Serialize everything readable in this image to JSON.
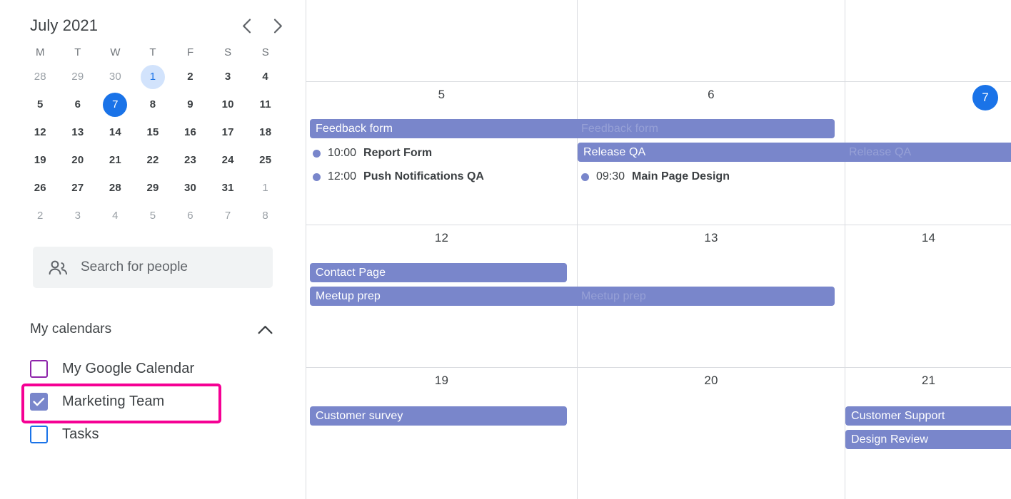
{
  "sidebar": {
    "mini_calendar": {
      "title": "July 2021",
      "prev_label": "‹",
      "next_label": "›",
      "day_initials": [
        "M",
        "T",
        "W",
        "T",
        "F",
        "S",
        "S"
      ],
      "weeks": [
        [
          {
            "n": "28",
            "state": "muted"
          },
          {
            "n": "29",
            "state": "muted"
          },
          {
            "n": "30",
            "state": "muted"
          },
          {
            "n": "1",
            "state": "selected"
          },
          {
            "n": "2",
            "state": "normal"
          },
          {
            "n": "3",
            "state": "normal"
          },
          {
            "n": "4",
            "state": "normal"
          }
        ],
        [
          {
            "n": "5",
            "state": "normal"
          },
          {
            "n": "6",
            "state": "normal"
          },
          {
            "n": "7",
            "state": "today"
          },
          {
            "n": "8",
            "state": "normal"
          },
          {
            "n": "9",
            "state": "normal"
          },
          {
            "n": "10",
            "state": "normal"
          },
          {
            "n": "11",
            "state": "normal"
          }
        ],
        [
          {
            "n": "12",
            "state": "normal"
          },
          {
            "n": "13",
            "state": "normal"
          },
          {
            "n": "14",
            "state": "normal"
          },
          {
            "n": "15",
            "state": "normal"
          },
          {
            "n": "16",
            "state": "normal"
          },
          {
            "n": "17",
            "state": "normal"
          },
          {
            "n": "18",
            "state": "normal"
          }
        ],
        [
          {
            "n": "19",
            "state": "normal"
          },
          {
            "n": "20",
            "state": "normal"
          },
          {
            "n": "21",
            "state": "normal"
          },
          {
            "n": "22",
            "state": "normal"
          },
          {
            "n": "23",
            "state": "normal"
          },
          {
            "n": "24",
            "state": "normal"
          },
          {
            "n": "25",
            "state": "normal"
          }
        ],
        [
          {
            "n": "26",
            "state": "normal"
          },
          {
            "n": "27",
            "state": "normal"
          },
          {
            "n": "28",
            "state": "normal"
          },
          {
            "n": "29",
            "state": "normal"
          },
          {
            "n": "30",
            "state": "normal"
          },
          {
            "n": "31",
            "state": "normal"
          },
          {
            "n": "1",
            "state": "muted"
          }
        ],
        [
          {
            "n": "2",
            "state": "muted"
          },
          {
            "n": "3",
            "state": "muted"
          },
          {
            "n": "4",
            "state": "muted"
          },
          {
            "n": "5",
            "state": "muted"
          },
          {
            "n": "6",
            "state": "muted"
          },
          {
            "n": "7",
            "state": "muted"
          },
          {
            "n": "8",
            "state": "muted"
          }
        ]
      ]
    },
    "people_search": {
      "placeholder": "Search for people",
      "icon": "people-icon"
    },
    "my_calendars": {
      "title": "My calendars",
      "collapse_icon": "chevron-up-icon",
      "items": [
        {
          "label": "My Google Calendar",
          "checked": false,
          "color": "#8e24aa",
          "highlighted": false
        },
        {
          "label": "Marketing Team",
          "checked": true,
          "color": "#7986cb",
          "highlighted": true
        },
        {
          "label": "Tasks",
          "checked": false,
          "color": "#1a73e8",
          "highlighted": false
        }
      ]
    }
  },
  "calendar": {
    "event_color": "#7986cb",
    "today_color": "#1a73e8",
    "grid_line_color": "#dadce0",
    "weeks": [
      {
        "days": [],
        "events": []
      },
      {
        "days": [
          {
            "n": "5",
            "today": false
          },
          {
            "n": "6",
            "today": false
          },
          {
            "n": "7",
            "today": true
          }
        ],
        "events": [
          {
            "title": "Feedback form",
            "kind": "allday"
          },
          {
            "title": "Feedback form",
            "kind": "allday-ghost"
          },
          {
            "title": "Release QA",
            "kind": "allday"
          },
          {
            "title": "Release QA",
            "kind": "allday-ghost"
          },
          {
            "time": "10:00",
            "title": "Report Form",
            "kind": "timed"
          },
          {
            "time": "12:00",
            "title": "Push Notifications QA",
            "kind": "timed"
          },
          {
            "time": "09:30",
            "title": "Main Page Design",
            "kind": "timed"
          }
        ]
      },
      {
        "days": [
          {
            "n": "12",
            "today": false
          },
          {
            "n": "13",
            "today": false
          },
          {
            "n": "14",
            "today": false
          }
        ],
        "events": [
          {
            "title": "Contact Page",
            "kind": "allday"
          },
          {
            "title": "Meetup prep",
            "kind": "allday"
          },
          {
            "title": "Meetup prep",
            "kind": "allday-ghost"
          }
        ]
      },
      {
        "days": [
          {
            "n": "19",
            "today": false
          },
          {
            "n": "20",
            "today": false
          },
          {
            "n": "21",
            "today": false
          }
        ],
        "events": [
          {
            "title": "Customer survey",
            "kind": "allday"
          },
          {
            "title": "Customer Support",
            "kind": "allday"
          },
          {
            "title": "Design Review",
            "kind": "allday"
          }
        ]
      }
    ],
    "labels": {
      "w1_d1": "5",
      "w1_d2": "6",
      "w1_d3": "7",
      "w2_d1": "12",
      "w2_d2": "13",
      "w2_d3": "14",
      "w3_d1": "19",
      "w3_d2": "20",
      "w3_d3": "21",
      "feedback_form": "Feedback form",
      "feedback_form_ghost": "Feedback form",
      "release_qa": "Release QA",
      "release_qa_ghost": "Release QA",
      "report_form_time": "10:00",
      "report_form_title": "Report Form",
      "push_notifications_time": "12:00",
      "push_notifications_title": "Push Notifications QA",
      "main_page_time": "09:30",
      "main_page_title": "Main Page Design",
      "contact_page": "Contact Page",
      "meetup_prep": "Meetup prep",
      "meetup_prep_ghost": "Meetup prep",
      "customer_survey": "Customer survey",
      "customer_support": "Customer Support",
      "design_review": "Design Review"
    }
  }
}
